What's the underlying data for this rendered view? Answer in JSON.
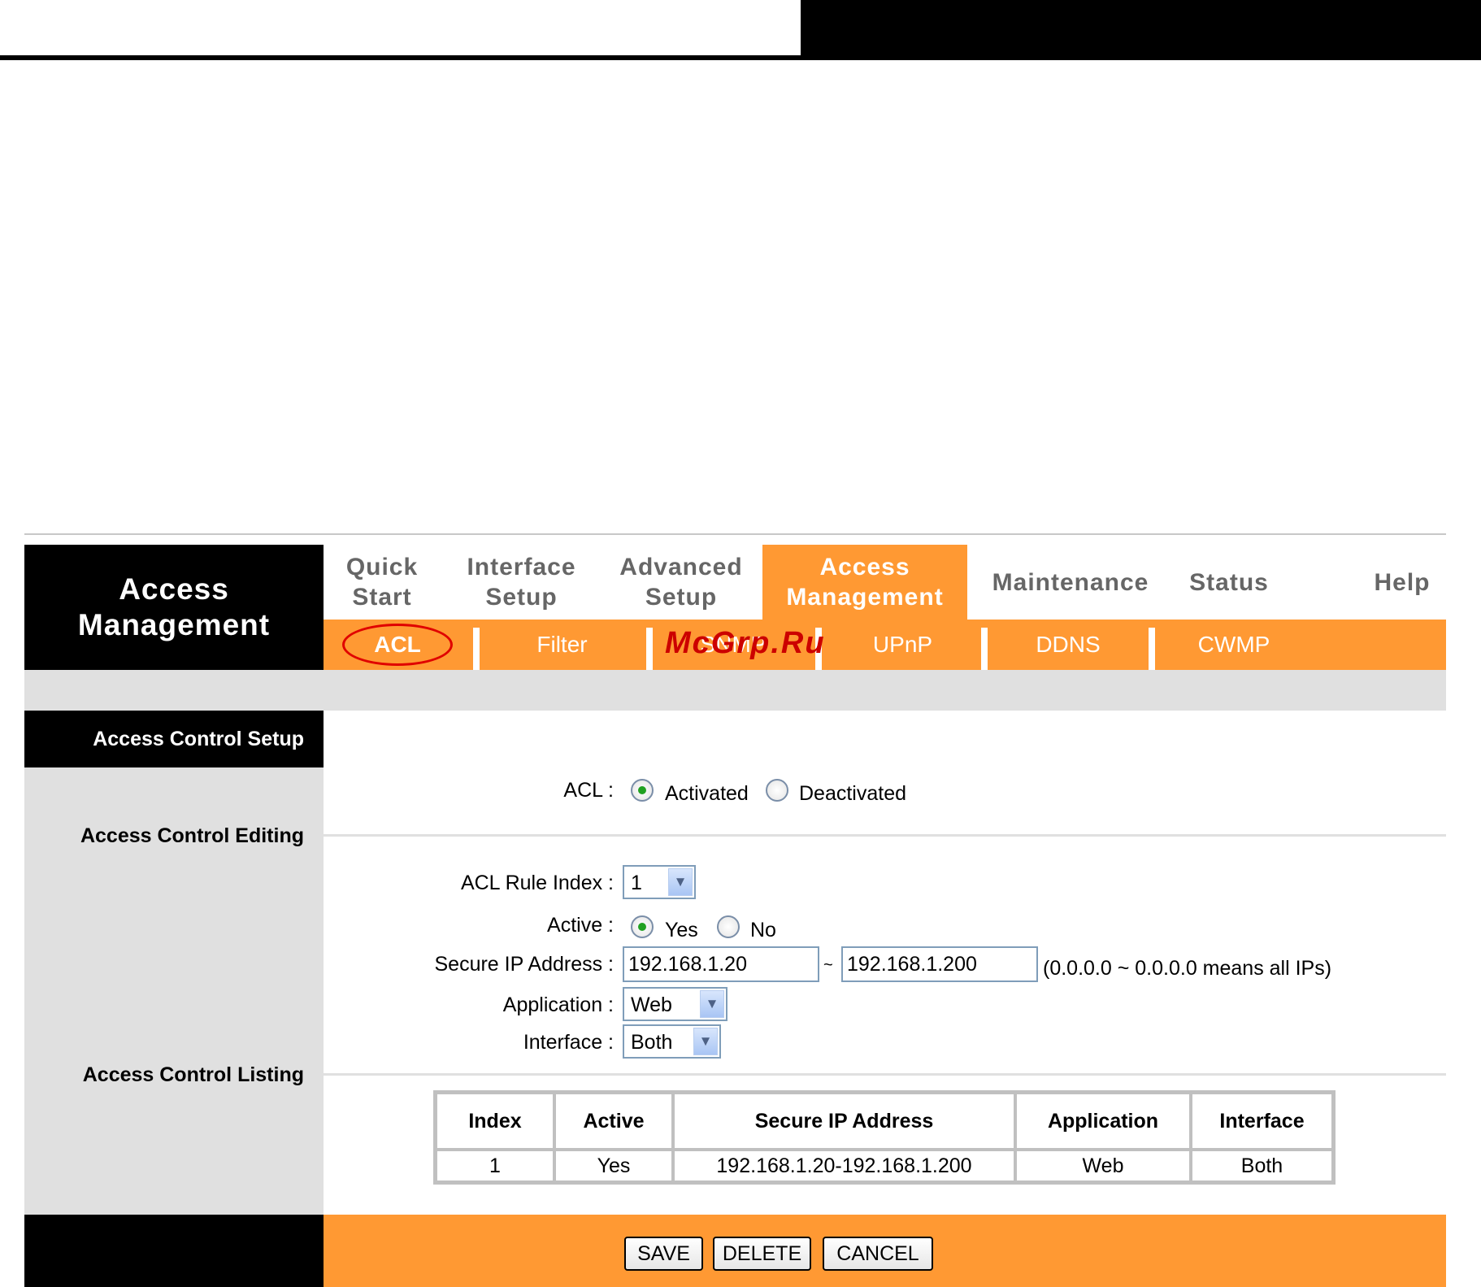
{
  "brand": {
    "line1": "Access",
    "line2": "Management"
  },
  "tabs": [
    {
      "line1": "Quick",
      "line2": "Start"
    },
    {
      "line1": "Interface",
      "line2": "Setup"
    },
    {
      "line1": "Advanced",
      "line2": "Setup"
    },
    {
      "line1": "Access",
      "line2": "Management",
      "active": true
    },
    {
      "line1": "Maintenance"
    },
    {
      "line1": "Status"
    },
    {
      "line1": "Help"
    }
  ],
  "subtabs": [
    "ACL",
    "Filter",
    "SNMP",
    "UPnP",
    "DDNS",
    "CWMP"
  ],
  "selected_subtab": "ACL",
  "watermark": "McGrp.Ru",
  "section": {
    "title": "Access Control Setup",
    "editing": "Access Control Editing",
    "listing": "Access Control Listing"
  },
  "acl": {
    "label": "ACL :",
    "activated": "Activated",
    "deactivated": "Deactivated",
    "value": "Activated"
  },
  "form": {
    "rule_index_label": "ACL Rule Index :",
    "rule_index_value": "1",
    "active_label": "Active :",
    "active_yes": "Yes",
    "active_no": "No",
    "active_value": "Yes",
    "secure_ip_label": "Secure IP Address :",
    "ip_start": "192.168.1.20",
    "ip_tilde": "~",
    "ip_end": "192.168.1.200",
    "ip_hint": "(0.0.0.0 ~ 0.0.0.0 means all IPs)",
    "application_label": "Application :",
    "application_value": "Web",
    "interface_label": "Interface :",
    "interface_value": "Both"
  },
  "listing": {
    "headers": [
      "Index",
      "Active",
      "Secure IP Address",
      "Application",
      "Interface"
    ],
    "rows": [
      [
        "1",
        "Yes",
        "192.168.1.20-192.168.1.200",
        "Web",
        "Both"
      ]
    ]
  },
  "buttons": {
    "save": "SAVE",
    "delete": "DELETE",
    "cancel": "CANCEL"
  },
  "colors": {
    "accent": "#ff9933",
    "dark": "#000000",
    "panel": "#e0e0e0",
    "tab_text": "#666666"
  }
}
